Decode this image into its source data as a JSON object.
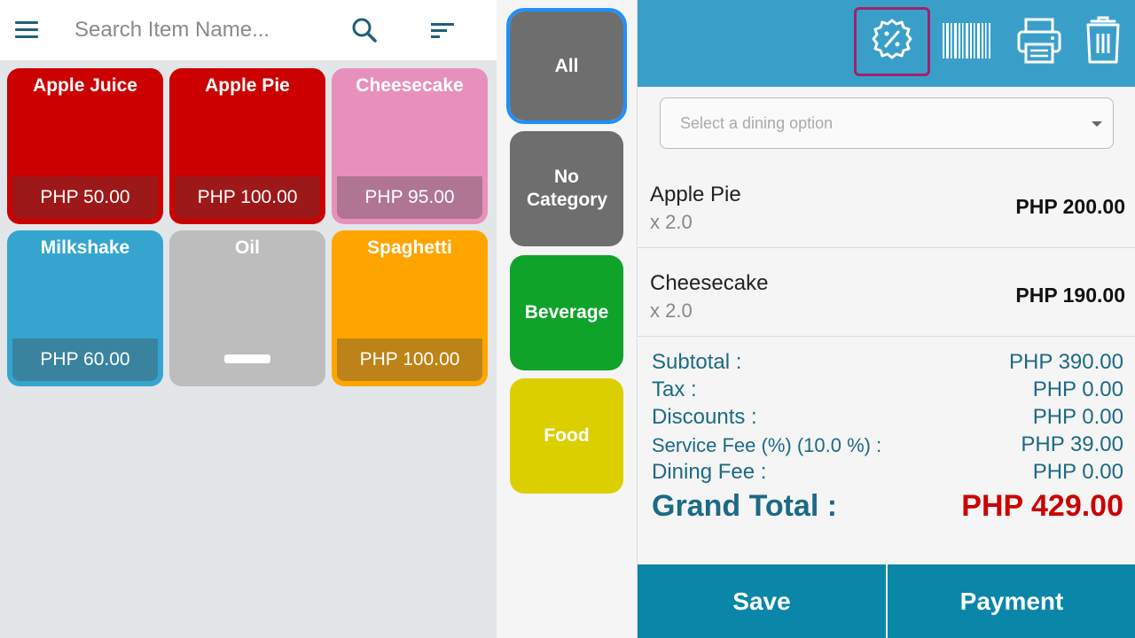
{
  "search": {
    "placeholder": "Search Item Name..."
  },
  "items": [
    {
      "name": "Apple Juice",
      "price": "PHP 50.00",
      "color": "#cc0000"
    },
    {
      "name": "Apple Pie",
      "price": "PHP 100.00",
      "color": "#cc0000"
    },
    {
      "name": "Cheesecake",
      "price": "PHP 95.00",
      "color": "#e890bc"
    },
    {
      "name": "Milkshake",
      "price": "PHP 60.00",
      "color": "#35a5cf"
    },
    {
      "name": "Oil",
      "price": "",
      "color": "#bdbdbd"
    },
    {
      "name": "Spaghetti",
      "price": "PHP 100.00",
      "color": "#ffa500"
    }
  ],
  "categories": [
    {
      "label": "All",
      "color": "#6e6e6e",
      "selected": true
    },
    {
      "label": "No Category",
      "color": "#6e6e6e",
      "selected": false
    },
    {
      "label": "Beverage",
      "color": "#0fa32a",
      "selected": false
    },
    {
      "label": "Food",
      "color": "#dccf00",
      "selected": false
    }
  ],
  "header_icons": [
    "discount-icon",
    "barcode-icon",
    "print-icon",
    "trash-icon"
  ],
  "dining": {
    "placeholder": "Select a dining option"
  },
  "order": [
    {
      "name": "Apple Pie",
      "qty": "x 2.0",
      "price": "PHP 200.00"
    },
    {
      "name": "Cheesecake",
      "qty": "x 2.0",
      "price": "PHP 190.00"
    }
  ],
  "summary": {
    "subtotal_label": "Subtotal :",
    "subtotal_value": "PHP 390.00",
    "tax_label": "Tax :",
    "tax_value": "PHP 0.00",
    "discounts_label": "Discounts :",
    "discounts_value": "PHP 0.00",
    "service_label": "Service Fee (%) (10.0 %) :",
    "service_value": "PHP 39.00",
    "dining_label": "Dining Fee :",
    "dining_value": "PHP 0.00",
    "grand_label": "Grand Total :",
    "grand_value": "PHP 429.00"
  },
  "buttons": {
    "save": "Save",
    "payment": "Payment"
  },
  "colors": {
    "accent": "#3a9fc8",
    "button": "#0a86a8",
    "total": "#cc0000",
    "summary_text": "#1c6a85"
  }
}
